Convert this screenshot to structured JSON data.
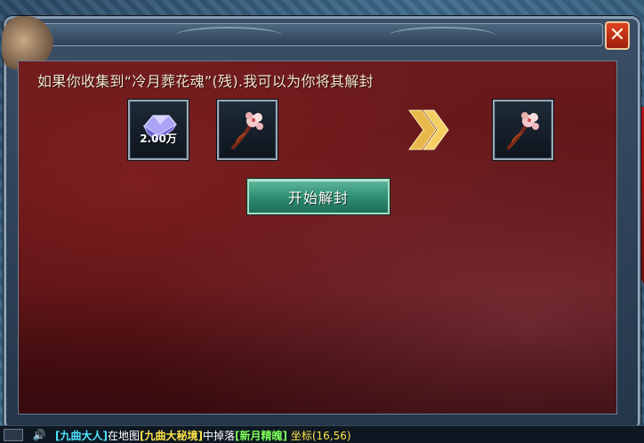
{
  "dialog": {
    "message": "如果你收集到“冷月葬花魂”(残).我可以为你将其解封",
    "close_icon": "close-icon",
    "currency_slot": {
      "icon": "gem-icon",
      "amount": "2.00万",
      "color": "#8c86e6"
    },
    "material_slot": {
      "icon": "flower-branch-icon"
    },
    "arrow_icon": "double-chevron-right-icon",
    "result_slot": {
      "icon": "flower-branch-icon"
    },
    "start_button": "开始解封"
  },
  "chat": {
    "sound_icon": "speaker-icon",
    "segments": {
      "name": "[九曲大人]",
      "text1": "在地图",
      "map": "[九曲大秘境]",
      "text2": "中掉落",
      "item": "[新月精魄]",
      "coord": "坐标(16,56)"
    }
  },
  "colors": {
    "panel_red": "#5a1214",
    "button_green": "#2e8f73",
    "close_red": "#d43a1a",
    "arrow_gold": "#e8b84a"
  }
}
